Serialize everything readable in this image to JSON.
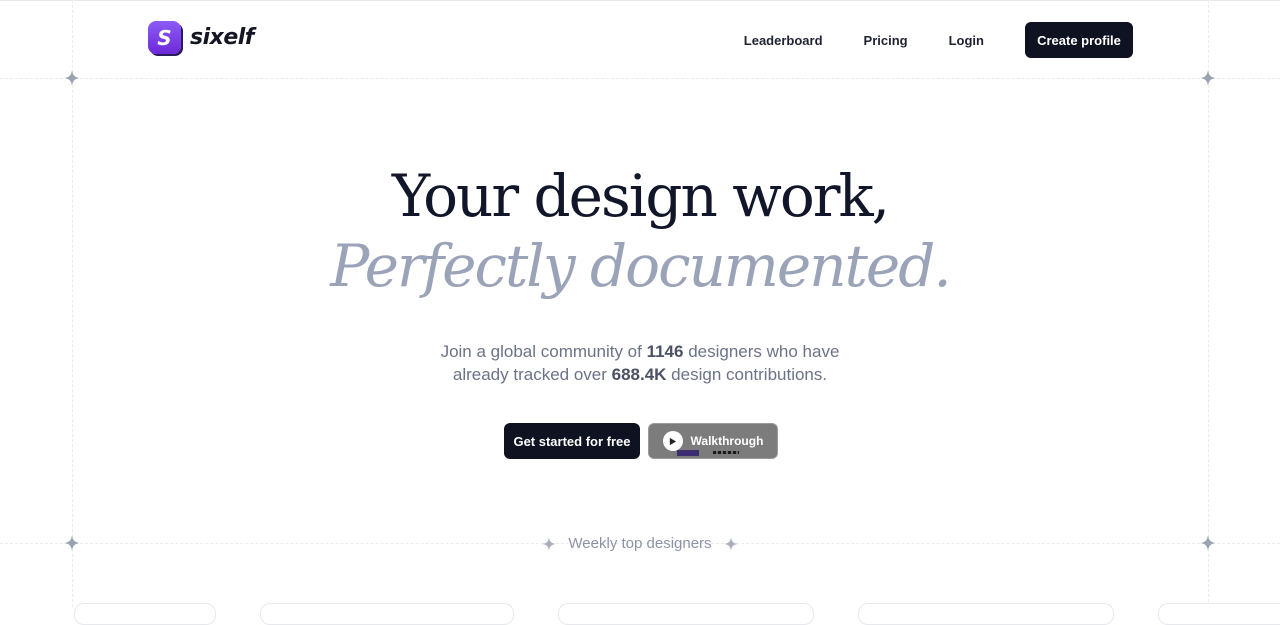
{
  "brand": {
    "name": "sixelf",
    "mark": "S",
    "color": "#7c3aed"
  },
  "nav": {
    "links": [
      "Leaderboard",
      "Pricing",
      "Login"
    ],
    "cta": "Create profile"
  },
  "hero": {
    "title": "Your design work,",
    "subtitle": "Perfectly documented.",
    "desc_prefix": "Join a global community of ",
    "designers_count": "1146",
    "desc_middle": " designers who have",
    "desc_line2_prefix": "already tracked over ",
    "contributions": "688.4K",
    "desc_suffix": " design contributions.",
    "primary_cta": "Get started for free",
    "secondary_cta": "Walkthrough"
  },
  "weekly": {
    "label": "Weekly top designers"
  },
  "icons": {
    "sparkle": "sparkle-icon",
    "play": "play-icon"
  },
  "colors": {
    "dark": "#0f1221",
    "muted": "#9aa3b8",
    "accent": "#7c3aed"
  }
}
